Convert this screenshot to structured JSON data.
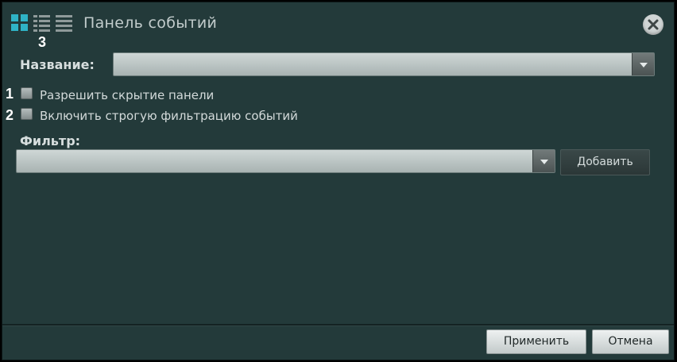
{
  "window": {
    "title": "Панель событий",
    "view_icons": [
      "grid-view-icon",
      "detailed-list-view-icon",
      "list-view-icon"
    ],
    "close_icon": "close-icon"
  },
  "markers": [
    "1",
    "2",
    "3"
  ],
  "form": {
    "name_label": "Название:",
    "name_value": "",
    "allow_hide_label": "Разрешить скрытие панели",
    "allow_hide_checked": false,
    "strict_filter_label": "Включить строгую фильтрацию событий",
    "strict_filter_checked": false,
    "filter_label": "Фильтр:",
    "filter_value": "",
    "add_button": "Добавить"
  },
  "footer": {
    "apply_button": "Применить",
    "cancel_button": "Отмена"
  },
  "colors": {
    "background": "#233a3a",
    "accent_icon": "#2fb3c6"
  }
}
